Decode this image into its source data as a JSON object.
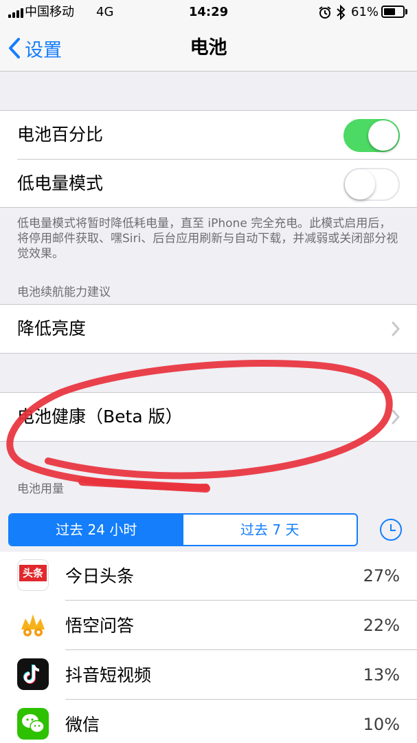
{
  "status_bar": {
    "carrier": "中国移动",
    "network": "4G",
    "time": "14:29",
    "battery_percent": "61%",
    "battery_level": 0.61,
    "icons": [
      "signal-icon",
      "alarm-icon",
      "bluetooth-icon",
      "battery-icon"
    ]
  },
  "nav": {
    "back_label": "设置",
    "title": "电池"
  },
  "settings": {
    "battery_percentage_label": "电池百分比",
    "battery_percentage_on": true,
    "low_power_label": "低电量模式",
    "low_power_on": false,
    "low_power_footnote": "低电量模式将暂时降低耗电量，直至 iPhone 完全充电。此模式启用后，将停用邮件获取、嘿Siri、后台应用刷新与自动下载，并减弱或关闭部分视觉效果。",
    "suggestions_header": "电池续航能力建议",
    "lower_brightness_label": "降低亮度",
    "battery_health_label": "电池健康（Beta 版）",
    "usage_header": "电池用量"
  },
  "usage": {
    "tabs": [
      {
        "label": "过去 24 小时",
        "active": true
      },
      {
        "label": "过去 7 天",
        "active": false
      }
    ],
    "apps": [
      {
        "name": "今日头条",
        "percent": "27%",
        "icon": "toutiao-icon",
        "icon_text": "头条"
      },
      {
        "name": "悟空问答",
        "percent": "22%",
        "icon": "wukong-icon"
      },
      {
        "name": "抖音短视频",
        "percent": "13%",
        "icon": "douyin-icon"
      },
      {
        "name": "微信",
        "percent": "10%",
        "icon": "wechat-icon"
      }
    ]
  },
  "colors": {
    "accent": "#147efb",
    "toggle_on": "#4cd964",
    "annotation": "#e8323c"
  }
}
